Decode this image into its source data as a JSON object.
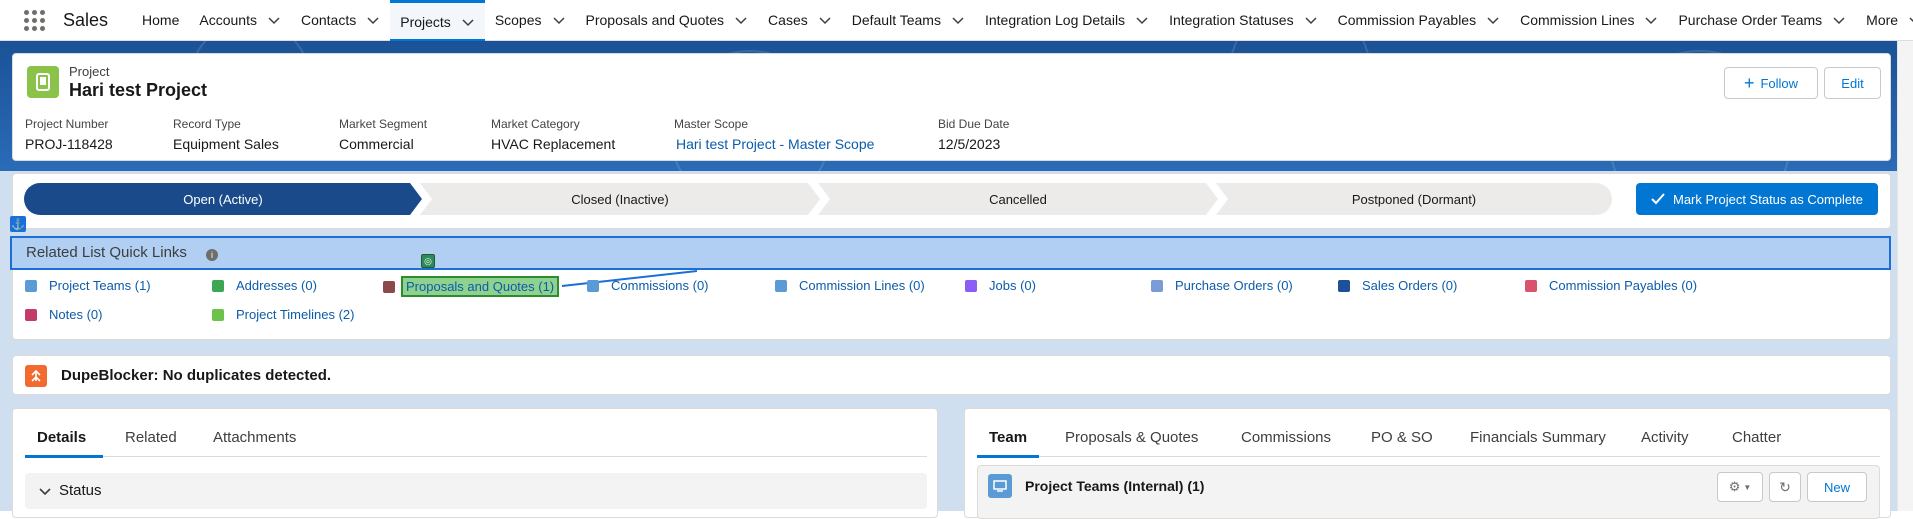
{
  "app": {
    "name": "Sales"
  },
  "nav": {
    "items": [
      {
        "label": "Home",
        "chevron": false
      },
      {
        "label": "Accounts",
        "chevron": true
      },
      {
        "label": "Contacts",
        "chevron": true
      },
      {
        "label": "Projects",
        "chevron": true,
        "active": true
      },
      {
        "label": "Scopes",
        "chevron": true
      },
      {
        "label": "Proposals and Quotes",
        "chevron": true
      },
      {
        "label": "Cases",
        "chevron": true
      },
      {
        "label": "Default Teams",
        "chevron": true
      },
      {
        "label": "Integration Log Details",
        "chevron": true
      },
      {
        "label": "Integration Statuses",
        "chevron": true
      },
      {
        "label": "Commission Payables",
        "chevron": true
      },
      {
        "label": "Commission Lines",
        "chevron": true
      },
      {
        "label": "Purchase Order Teams",
        "chevron": true
      },
      {
        "label": "More",
        "chevron": true
      }
    ]
  },
  "header": {
    "object_label": "Project",
    "title": "Hari test Project",
    "follow_label": "Follow",
    "edit_label": "Edit",
    "fields": [
      {
        "label": "Project Number",
        "value": "PROJ-118428"
      },
      {
        "label": "Record Type",
        "value": "Equipment Sales"
      },
      {
        "label": "Market Segment",
        "value": "Commercial"
      },
      {
        "label": "Market Category",
        "value": "HVAC Replacement"
      },
      {
        "label": "Master Scope",
        "value": "Hari test Project - Master Scope",
        "link": true
      },
      {
        "label": "Bid Due Date",
        "value": "12/5/2023"
      }
    ]
  },
  "path": {
    "stages": [
      "Open (Active)",
      "Closed (Inactive)",
      "Cancelled",
      "Postponed (Dormant)"
    ],
    "current": 0,
    "mark_complete_label": "Mark Project Status as Complete"
  },
  "quick_links": {
    "title": "Related List Quick Links",
    "links": [
      {
        "label": "Project Teams (1)",
        "color": "#5a9bd5"
      },
      {
        "label": "Addresses (0)",
        "color": "#3ba755"
      },
      {
        "label": "Proposals and Quotes (1)",
        "color": "#8b4a4a",
        "highlight": true
      },
      {
        "label": "Commissions (0)",
        "color": "#5a9bd5"
      },
      {
        "label": "Commission Lines (0)",
        "color": "#5a9bd5"
      },
      {
        "label": "Jobs (0)",
        "color": "#8b5cf6"
      },
      {
        "label": "Purchase Orders (0)",
        "color": "#7a9bd5"
      },
      {
        "label": "Sales Orders (0)",
        "color": "#1e4f99"
      },
      {
        "label": "Commission Payables (0)",
        "color": "#d9536d"
      },
      {
        "label": "Notes (0)",
        "color": "#c23b6a"
      },
      {
        "label": "Project Timelines (2)",
        "color": "#6cc24a"
      }
    ]
  },
  "dupeblocker": {
    "message": "DupeBlocker: No duplicates detected."
  },
  "left_tabs": {
    "items": [
      "Details",
      "Related",
      "Attachments"
    ],
    "active": 0
  },
  "status_section": {
    "label": "Status"
  },
  "right_tabs": {
    "items": [
      "Team",
      "Proposals & Quotes",
      "Commissions",
      "PO & SO",
      "Financials Summary",
      "Activity",
      "Chatter"
    ],
    "active": 0
  },
  "project_teams_card": {
    "title": "Project Teams (Internal) (1)",
    "new_label": "New"
  }
}
